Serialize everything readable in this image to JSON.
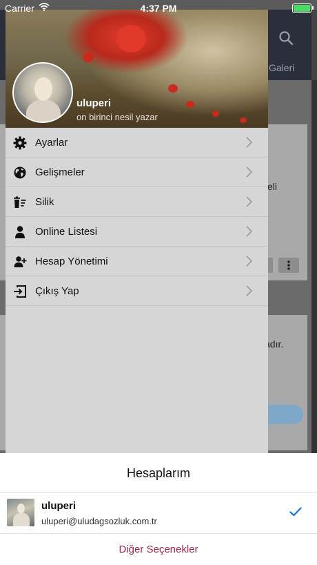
{
  "status": {
    "carrier": "Carrier",
    "time": "4:37 PM"
  },
  "background": {
    "tab_label": "Galeri",
    "text_snippet_1": "eli",
    "text_snippet_2": "adır."
  },
  "drawer": {
    "profile": {
      "name": "uluperi",
      "role": "on birinci nesil  yazar"
    },
    "items": [
      {
        "label": "Ayarlar",
        "icon": "gear-icon"
      },
      {
        "label": "Gelişmeler",
        "icon": "globe-icon"
      },
      {
        "label": "Silik",
        "icon": "trash-list-icon"
      },
      {
        "label": "Online Listesi",
        "icon": "person-icon"
      },
      {
        "label": "Hesap Yönetimi",
        "icon": "person-add-icon"
      },
      {
        "label": "Çıkış Yap",
        "icon": "exit-icon"
      }
    ]
  },
  "sheet": {
    "title": "Hesaplarım",
    "account": {
      "name": "uluperi",
      "email": "uluperi@uludagsozluk.com.tr",
      "selected": true
    },
    "more_label": "Diğer Seçenekler"
  },
  "colors": {
    "accent": "#9c2b48",
    "check": "#1a73d9",
    "battery": "#4cd964"
  }
}
